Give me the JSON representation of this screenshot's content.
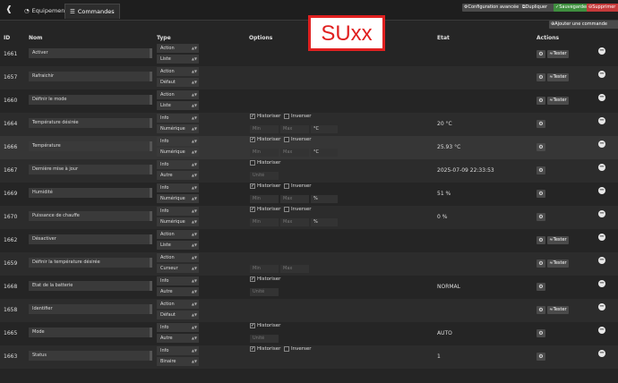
{
  "topbar": {
    "back_icon": "arrow-left-circle-icon",
    "tabs": [
      {
        "label": "Equipement",
        "icon": "tachometer-icon"
      },
      {
        "label": "Commandes",
        "icon": "list-icon"
      }
    ],
    "buttons": {
      "advanced": "Configuration avancée",
      "duplicate": "Dupliquer",
      "save": "Sauvegarder",
      "delete": "Supprimer"
    }
  },
  "add_command": "Ajouter une commande",
  "annotation": "SUxx",
  "headers": {
    "id": "ID",
    "nom": "Nom",
    "type": "Type",
    "options": "Options",
    "etat": "Etat",
    "actions": "Actions"
  },
  "labels": {
    "historiser": "Historiser",
    "inverser": "Inverser",
    "min": "Min",
    "max": "Max",
    "unite": "Unité",
    "tester": "Tester"
  },
  "rows": [
    {
      "id": "1661",
      "name": "Activer",
      "type1": "Action",
      "type2": "Liste"
    },
    {
      "id": "1657",
      "name": "Rafraichir",
      "type1": "Action",
      "type2": "Défaut"
    },
    {
      "id": "1660",
      "name": "Définir le mode",
      "type1": "Action",
      "type2": "Liste"
    },
    {
      "id": "1664",
      "name": "Température désirée",
      "type1": "Info",
      "type2": "Numérique",
      "unit": "°C",
      "etat": "20 °C"
    },
    {
      "id": "1666",
      "name": "Température",
      "type1": "Info",
      "type2": "Numérique",
      "unit": "°C",
      "etat": "25.93 °C"
    },
    {
      "id": "1667",
      "name": "Dernière mise à jour",
      "type1": "Info",
      "type2": "Autre",
      "etat": "2025-07-09 22:33:53"
    },
    {
      "id": "1669",
      "name": "Humidité",
      "type1": "Info",
      "type2": "Numérique",
      "unit": "%",
      "etat": "51 %"
    },
    {
      "id": "1670",
      "name": "Puissance de chauffe",
      "type1": "Info",
      "type2": "Numérique",
      "unit": "%",
      "etat": "0 %"
    },
    {
      "id": "1662",
      "name": "Désactiver",
      "type1": "Action",
      "type2": "Liste"
    },
    {
      "id": "1659",
      "name": "Définir la température désirée",
      "type1": "Action",
      "type2": "Curseur"
    },
    {
      "id": "1668",
      "name": "Etat de la batterie",
      "type1": "Info",
      "type2": "Autre",
      "etat": "NORMAL"
    },
    {
      "id": "1658",
      "name": "Identifier",
      "type1": "Action",
      "type2": "Défaut"
    },
    {
      "id": "1665",
      "name": "Mode",
      "type1": "Info",
      "type2": "Autre",
      "etat": "AUTO"
    },
    {
      "id": "1663",
      "name": "Status",
      "type1": "Info",
      "type2": "Binaire",
      "etat": "1"
    }
  ]
}
